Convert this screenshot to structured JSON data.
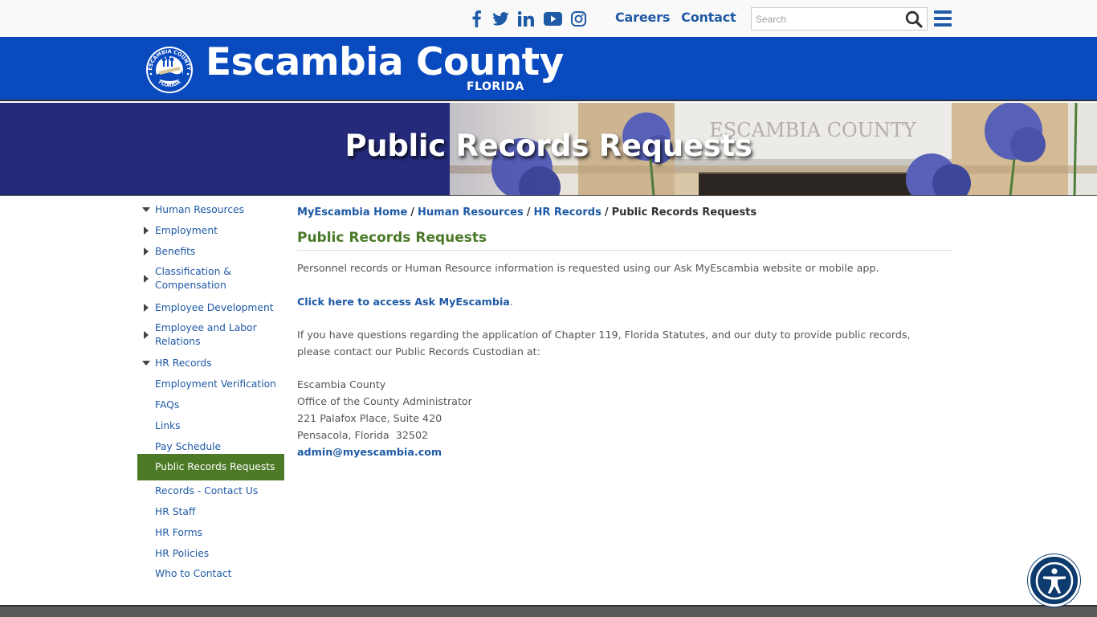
{
  "topbar": {
    "social": [
      {
        "name": "facebook-icon",
        "label": "Facebook"
      },
      {
        "name": "twitter-icon",
        "label": "Twitter"
      },
      {
        "name": "linkedin-icon",
        "label": "LinkedIn"
      },
      {
        "name": "youtube-icon",
        "label": "YouTube"
      },
      {
        "name": "instagram-icon",
        "label": "Instagram"
      }
    ],
    "links": [
      "Careers",
      "Contact"
    ],
    "search": {
      "placeholder": "Search",
      "value": ""
    }
  },
  "brand": {
    "title": "Escambia County",
    "subtitle": "FLORIDA",
    "seal_top_text": "ESCAMBIA COUNTY",
    "seal_bottom_text": "FLORIDA"
  },
  "hero": {
    "title": "Public Records Requests",
    "photo_sign_text": "ESCAMBIA COUNTY"
  },
  "sidebar": {
    "items": [
      {
        "label": "Human Resources",
        "arrow": "down",
        "indent": 0
      },
      {
        "label": "Employment",
        "arrow": "right",
        "indent": 0
      },
      {
        "label": "Benefits",
        "arrow": "right",
        "indent": 0
      },
      {
        "label": "Classification & Compensation",
        "arrow": "right",
        "indent": 0
      },
      {
        "label": "Employee Development",
        "arrow": "right",
        "indent": 0
      },
      {
        "label": "Employee and Labor Relations",
        "arrow": "right",
        "indent": 0
      },
      {
        "label": "HR Records",
        "arrow": "down",
        "indent": 0
      },
      {
        "label": "Employment Verification",
        "arrow": "none",
        "indent": 1
      },
      {
        "label": "FAQs",
        "arrow": "none",
        "indent": 1
      },
      {
        "label": "Links",
        "arrow": "none",
        "indent": 1
      },
      {
        "label": "Pay Schedule",
        "arrow": "none",
        "indent": 1
      },
      {
        "label": "Public Records Requests",
        "arrow": "none",
        "indent": 1,
        "active": true
      },
      {
        "label": "Records - Contact Us",
        "arrow": "none",
        "indent": 1
      },
      {
        "label": "HR Staff",
        "arrow": "none",
        "indent": 1
      },
      {
        "label": "HR Forms",
        "arrow": "none",
        "indent": 1
      },
      {
        "label": "HR Policies",
        "arrow": "none",
        "indent": 1
      },
      {
        "label": "Who to Contact",
        "arrow": "none",
        "indent": 1
      }
    ]
  },
  "breadcrumb": {
    "items": [
      "MyEscambia Home",
      "Human Resources",
      "HR Records"
    ],
    "separator": "/",
    "current": "Public Records Requests"
  },
  "main": {
    "title": "Public Records Requests",
    "intro": "Personnel records or Human Resource information is requested using our Ask MyEscambia website or mobile app.",
    "access_link": "Click here to access Ask MyEscambia",
    "access_link_suffix": ".",
    "question": "If you have questions regarding the application of Chapter 119, Florida Statutes, and our duty to provide public records, please contact our Public Records Custodian at:",
    "address": [
      "Escambia County",
      "Office of the County Administrator",
      "221 Palafox Place, Suite 420",
      "Pensacola, Florida  32502"
    ],
    "email": "admin@myescambia.com"
  },
  "accessibility": {
    "label": "Accessibility options"
  },
  "colors": {
    "brand_blue": "#0a4abf",
    "link_blue": "#1f5aa6",
    "hero_navy": "#252b7a",
    "active_green": "#4c7a27",
    "title_green": "#4a7a28",
    "footer_gray": "#5a5a5a",
    "a11y_navy": "#0d3b6e"
  }
}
